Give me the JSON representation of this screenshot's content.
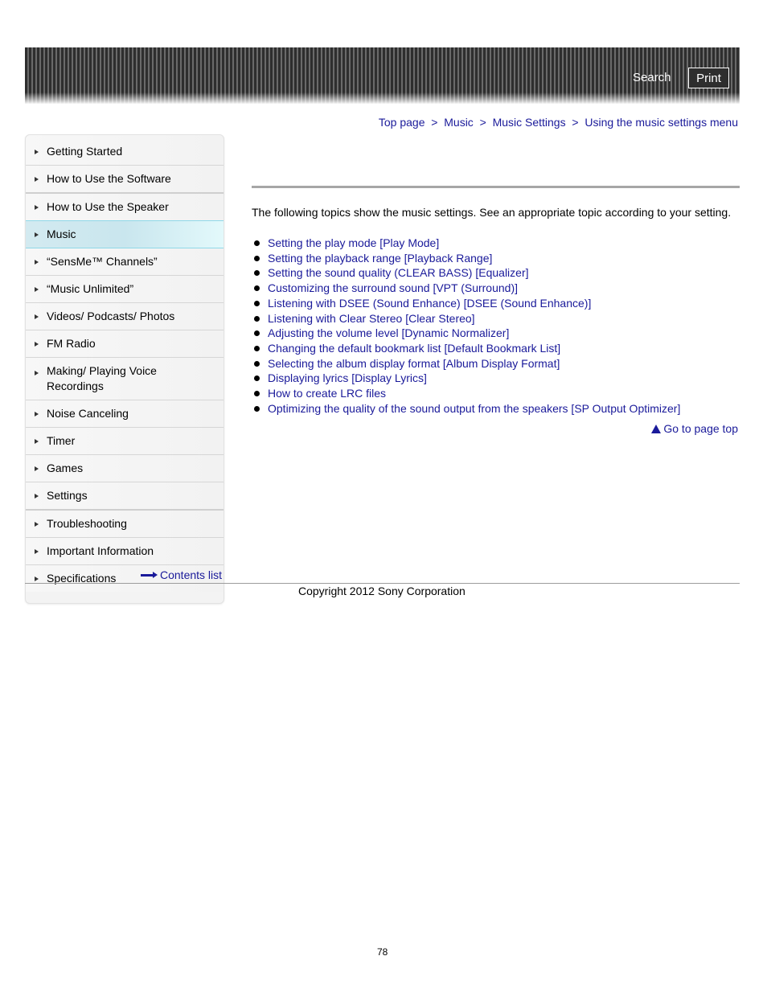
{
  "header": {
    "search_label": "Search",
    "print_label": "Print"
  },
  "breadcrumb": {
    "items": [
      "Top page",
      "Music",
      "Music Settings",
      "Using the music settings menu"
    ],
    "separator": ">"
  },
  "sidebar": {
    "active_index": 3,
    "items": [
      {
        "label": "Getting Started"
      },
      {
        "label": "How to Use the Software"
      },
      {
        "label": "How to Use the Speaker"
      },
      {
        "label": "Music"
      },
      {
        "label": "“SensMe™ Channels”"
      },
      {
        "label": "“Music Unlimited”"
      },
      {
        "label": "Videos/ Podcasts/ Photos"
      },
      {
        "label": "FM Radio"
      },
      {
        "label": "Making/ Playing Voice Recordings"
      },
      {
        "label": "Noise Canceling"
      },
      {
        "label": "Timer"
      },
      {
        "label": "Games"
      },
      {
        "label": "Settings"
      },
      {
        "label": "Troubleshooting"
      },
      {
        "label": "Important Information"
      },
      {
        "label": "Specifications"
      }
    ],
    "contents_list_label": "Contents list"
  },
  "main": {
    "intro": "The following topics show the music settings. See an appropriate topic according to your setting.",
    "topics": [
      "Setting the play mode [Play Mode]",
      "Setting the playback range [Playback Range]",
      "Setting the sound quality (CLEAR BASS) [Equalizer]",
      "Customizing the surround sound [VPT (Surround)]",
      "Listening with DSEE (Sound Enhance) [DSEE (Sound Enhance)]",
      "Listening with Clear Stereo [Clear Stereo]",
      "Adjusting the volume level [Dynamic Normalizer]",
      "Changing the default bookmark list [Default Bookmark List]",
      "Selecting the album display format [Album Display Format]",
      "Displaying lyrics [Display Lyrics]",
      "How to create LRC files",
      "Optimizing the quality of the sound output from the speakers [SP Output Optimizer]"
    ],
    "go_to_top_label": "Go to page top"
  },
  "footer": {
    "copyright": "Copyright 2012 Sony Corporation",
    "page_number": "78"
  },
  "colors": {
    "link": "#1a1a9a",
    "active_nav": "#c9e6ee",
    "header_dark": "#2e2e2e"
  }
}
